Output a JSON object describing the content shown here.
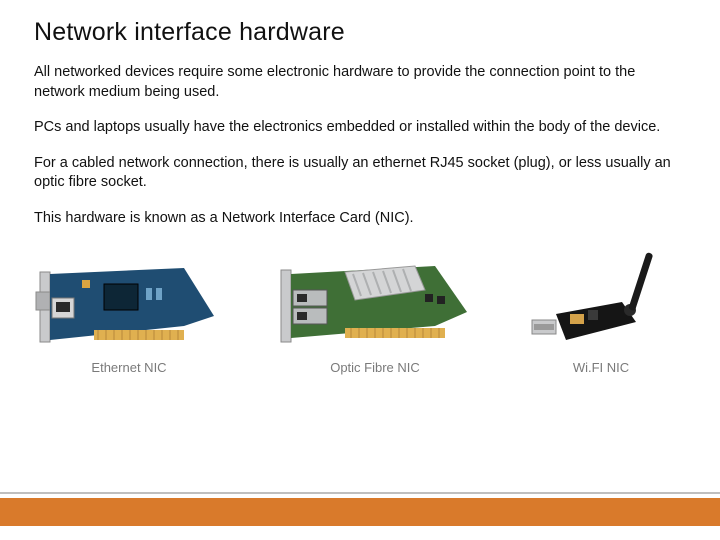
{
  "title": "Network interface hardware",
  "paragraphs": [
    "All networked devices require some electronic hardware to provide the connection point to the network medium being used.",
    "PCs and laptops usually have the electronics embedded or installed within the body of the device.",
    "For a cabled network connection, there is usually an ethernet RJ45 socket (plug), or less usually an optic fibre socket.",
    "This hardware is known as a Network Interface Card (NIC)."
  ],
  "figures": [
    {
      "caption": "Ethernet NIC"
    },
    {
      "caption": "Optic Fibre NIC"
    },
    {
      "caption": "Wi.FI NIC"
    }
  ],
  "accent_color": "#d97a2b"
}
